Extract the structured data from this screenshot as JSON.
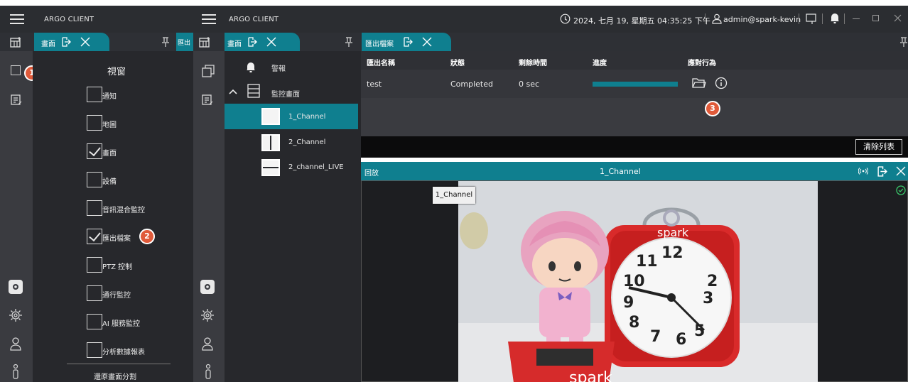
{
  "left_window": {
    "title": "ARGO CLIENT",
    "tab_label": "畫面",
    "tab2_label": "匯出",
    "window_panel": {
      "heading": "視窗",
      "items": [
        {
          "label": "通知",
          "checked": false
        },
        {
          "label": "地圖",
          "checked": false
        },
        {
          "label": "畫面",
          "checked": true
        },
        {
          "label": "設備",
          "checked": false
        },
        {
          "label": "音訊混合監控",
          "checked": false
        },
        {
          "label": "匯出檔案",
          "checked": true
        },
        {
          "label": "PTZ 控制",
          "checked": false
        },
        {
          "label": "通行監控",
          "checked": false
        },
        {
          "label": "AI 服務監控",
          "checked": false
        },
        {
          "label": "分析數據報表",
          "checked": false
        }
      ],
      "restore_label": "還原畫面分割"
    },
    "badges": {
      "b1": "1",
      "b2": "2"
    }
  },
  "right_window": {
    "title": "ARGO CLIENT",
    "datetime": "2024, 七月 19, 星期五 04:35:25 下午",
    "user": "admin@spark-kevin",
    "screen_tab_label": "畫面",
    "tree": {
      "alarm_label": "警報",
      "monitor_label": "監控畫面",
      "layouts": [
        {
          "label": "1_Channel",
          "selected": true
        },
        {
          "label": "2_Channel",
          "selected": false
        },
        {
          "label": "2_channel_LIVE",
          "selected": false
        }
      ]
    },
    "export": {
      "tab_label": "匯出檔案",
      "columns": [
        "匯出名稱",
        "狀態",
        "剩餘時間",
        "進度",
        "應對行為"
      ],
      "rows": [
        {
          "name": "test",
          "status": "Completed",
          "remaining": "0 sec",
          "progress": 1.0
        }
      ],
      "clear_label": "清除列表",
      "badge3": "3"
    },
    "playback": {
      "label": "回放",
      "channel": "1_Channel",
      "overlay_label": "1_Channel",
      "clock_brand": "spark",
      "base_brand": "spark"
    }
  },
  "colors": {
    "accent": "#0f7f8f",
    "badge": "#e05a3a"
  }
}
